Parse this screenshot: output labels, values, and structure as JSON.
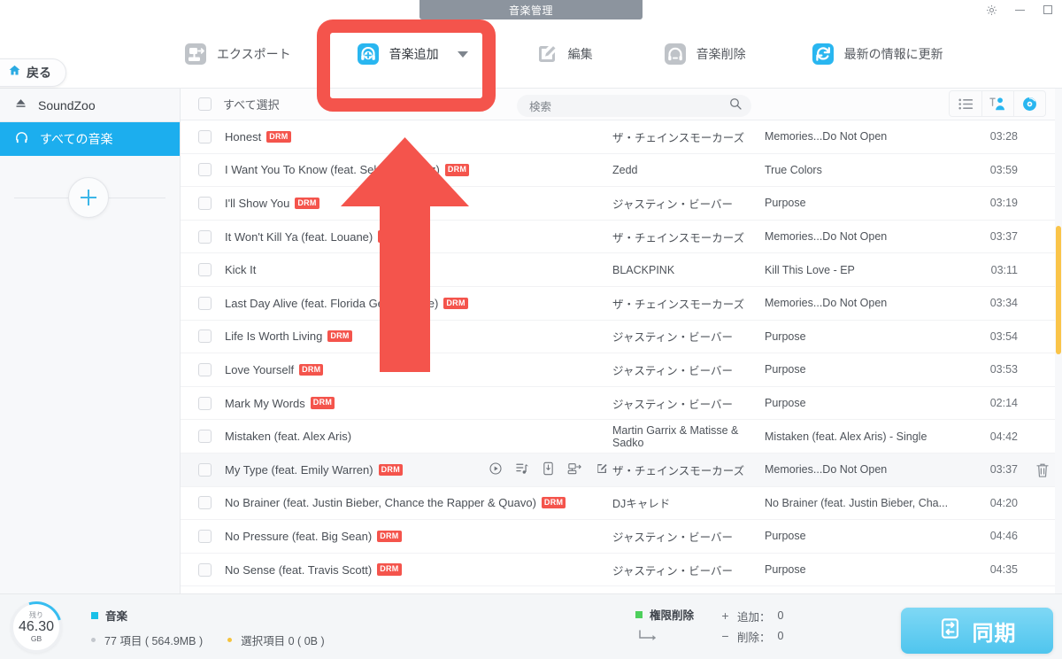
{
  "window": {
    "title": "音楽管理",
    "controls": {
      "settings": "gear-icon",
      "minimize": "minimize",
      "maximize": "maximize"
    }
  },
  "toolbar": {
    "back_label": "戻る",
    "items": [
      {
        "label": "エクスポート",
        "icon": "export-icon",
        "highlighted": false
      },
      {
        "label": "音楽追加",
        "icon": "add-music-icon",
        "highlighted": true,
        "has_dropdown": true
      },
      {
        "label": "編集",
        "icon": "edit-icon",
        "highlighted": false
      },
      {
        "label": "音楽削除",
        "icon": "delete-music-icon",
        "highlighted": false
      },
      {
        "label": "最新の情報に更新",
        "icon": "refresh-icon",
        "highlighted": false
      }
    ]
  },
  "sidebar": {
    "device_name": "SoundZoo",
    "device_icon": "eject-icon",
    "items": [
      {
        "label": "すべての音楽",
        "icon": "headphones-icon",
        "selected": true
      }
    ],
    "add_playlist_label": "+"
  },
  "list_header": {
    "select_all_label": "すべて選択",
    "search_placeholder": "検索",
    "search_value": "",
    "views": [
      {
        "name": "list-view",
        "active": false
      },
      {
        "name": "artist-view",
        "active": true
      },
      {
        "name": "album-view",
        "active": true
      }
    ]
  },
  "tracks": [
    {
      "title": "Honest",
      "drm": true,
      "artist": "ザ・チェインスモーカーズ",
      "album": "Memories...Do Not Open",
      "time": "03:28",
      "hover": false
    },
    {
      "title": "I Want You To Know (feat. Selena Gomez)",
      "drm": true,
      "artist": "Zedd",
      "album": "True Colors",
      "time": "03:59",
      "hover": false
    },
    {
      "title": "I'll Show You",
      "drm": true,
      "artist": "ジャスティン・ビーバー",
      "album": "Purpose",
      "time": "03:19",
      "hover": false
    },
    {
      "title": "It Won't Kill Ya (feat. Louane)",
      "drm": true,
      "artist": "ザ・チェインスモーカーズ",
      "album": "Memories...Do Not Open",
      "time": "03:37",
      "hover": false
    },
    {
      "title": "Kick It",
      "drm": false,
      "artist": "BLACKPINK",
      "album": "Kill This Love - EP",
      "time": "03:11",
      "hover": false
    },
    {
      "title": "Last Day Alive (feat. Florida Georgia Line)",
      "drm": true,
      "artist": "ザ・チェインスモーカーズ",
      "album": "Memories...Do Not Open",
      "time": "03:34",
      "hover": false
    },
    {
      "title": "Life Is Worth Living",
      "drm": true,
      "artist": "ジャスティン・ビーバー",
      "album": "Purpose",
      "time": "03:54",
      "hover": false
    },
    {
      "title": "Love Yourself",
      "drm": true,
      "artist": "ジャスティン・ビーバー",
      "album": "Purpose",
      "time": "03:53",
      "hover": false
    },
    {
      "title": "Mark My Words",
      "drm": true,
      "artist": "ジャスティン・ビーバー",
      "album": "Purpose",
      "time": "02:14",
      "hover": false
    },
    {
      "title": "Mistaken (feat. Alex Aris)",
      "drm": false,
      "artist": "Martin Garrix & Matisse & Sadko",
      "album": "Mistaken (feat. Alex Aris) - Single",
      "time": "04:42",
      "hover": false
    },
    {
      "title": "My Type (feat. Emily Warren)",
      "drm": true,
      "artist": "ザ・チェインスモーカーズ",
      "album": "Memories...Do Not Open",
      "time": "03:37",
      "hover": true
    },
    {
      "title": "No Brainer (feat. Justin Bieber, Chance the Rapper & Quavo)",
      "drm": true,
      "artist": "DJキャレド",
      "album": "No Brainer (feat. Justin Bieber, Cha...",
      "time": "04:20",
      "hover": false
    },
    {
      "title": "No Pressure (feat. Big Sean)",
      "drm": true,
      "artist": "ジャスティン・ビーバー",
      "album": "Purpose",
      "time": "04:46",
      "hover": false
    },
    {
      "title": "No Sense (feat. Travis Scott)",
      "drm": true,
      "artist": "ジャスティン・ビーバー",
      "album": "Purpose",
      "time": "04:35",
      "hover": false
    }
  ],
  "row_actions": [
    "play-icon",
    "add-to-playlist-icon",
    "to-device-icon",
    "export-icon",
    "edit-icon"
  ],
  "row_delete_icon": "trash-icon",
  "drm_badge_label": "DRM",
  "status": {
    "storage_caption": "残り",
    "storage_value": "46.30",
    "storage_unit": "GB",
    "category_label": "音楽",
    "items_label": "77 項目 ( 564.9MB )",
    "selected_label": "選択項目 0 ( 0B )",
    "drm_removal_label": "権限削除",
    "add_label": "追加：",
    "add_count": "0",
    "remove_label": "削除：",
    "remove_count": "0",
    "sync_label": "同期"
  },
  "colors": {
    "accent": "#1caeee",
    "annotation": "#f4544c",
    "drm_badge": "#f4544c",
    "scrollbar": "#fac449",
    "sync_gradient_top": "#7fd8f5",
    "sync_gradient_bottom": "#4fc5ee"
  }
}
